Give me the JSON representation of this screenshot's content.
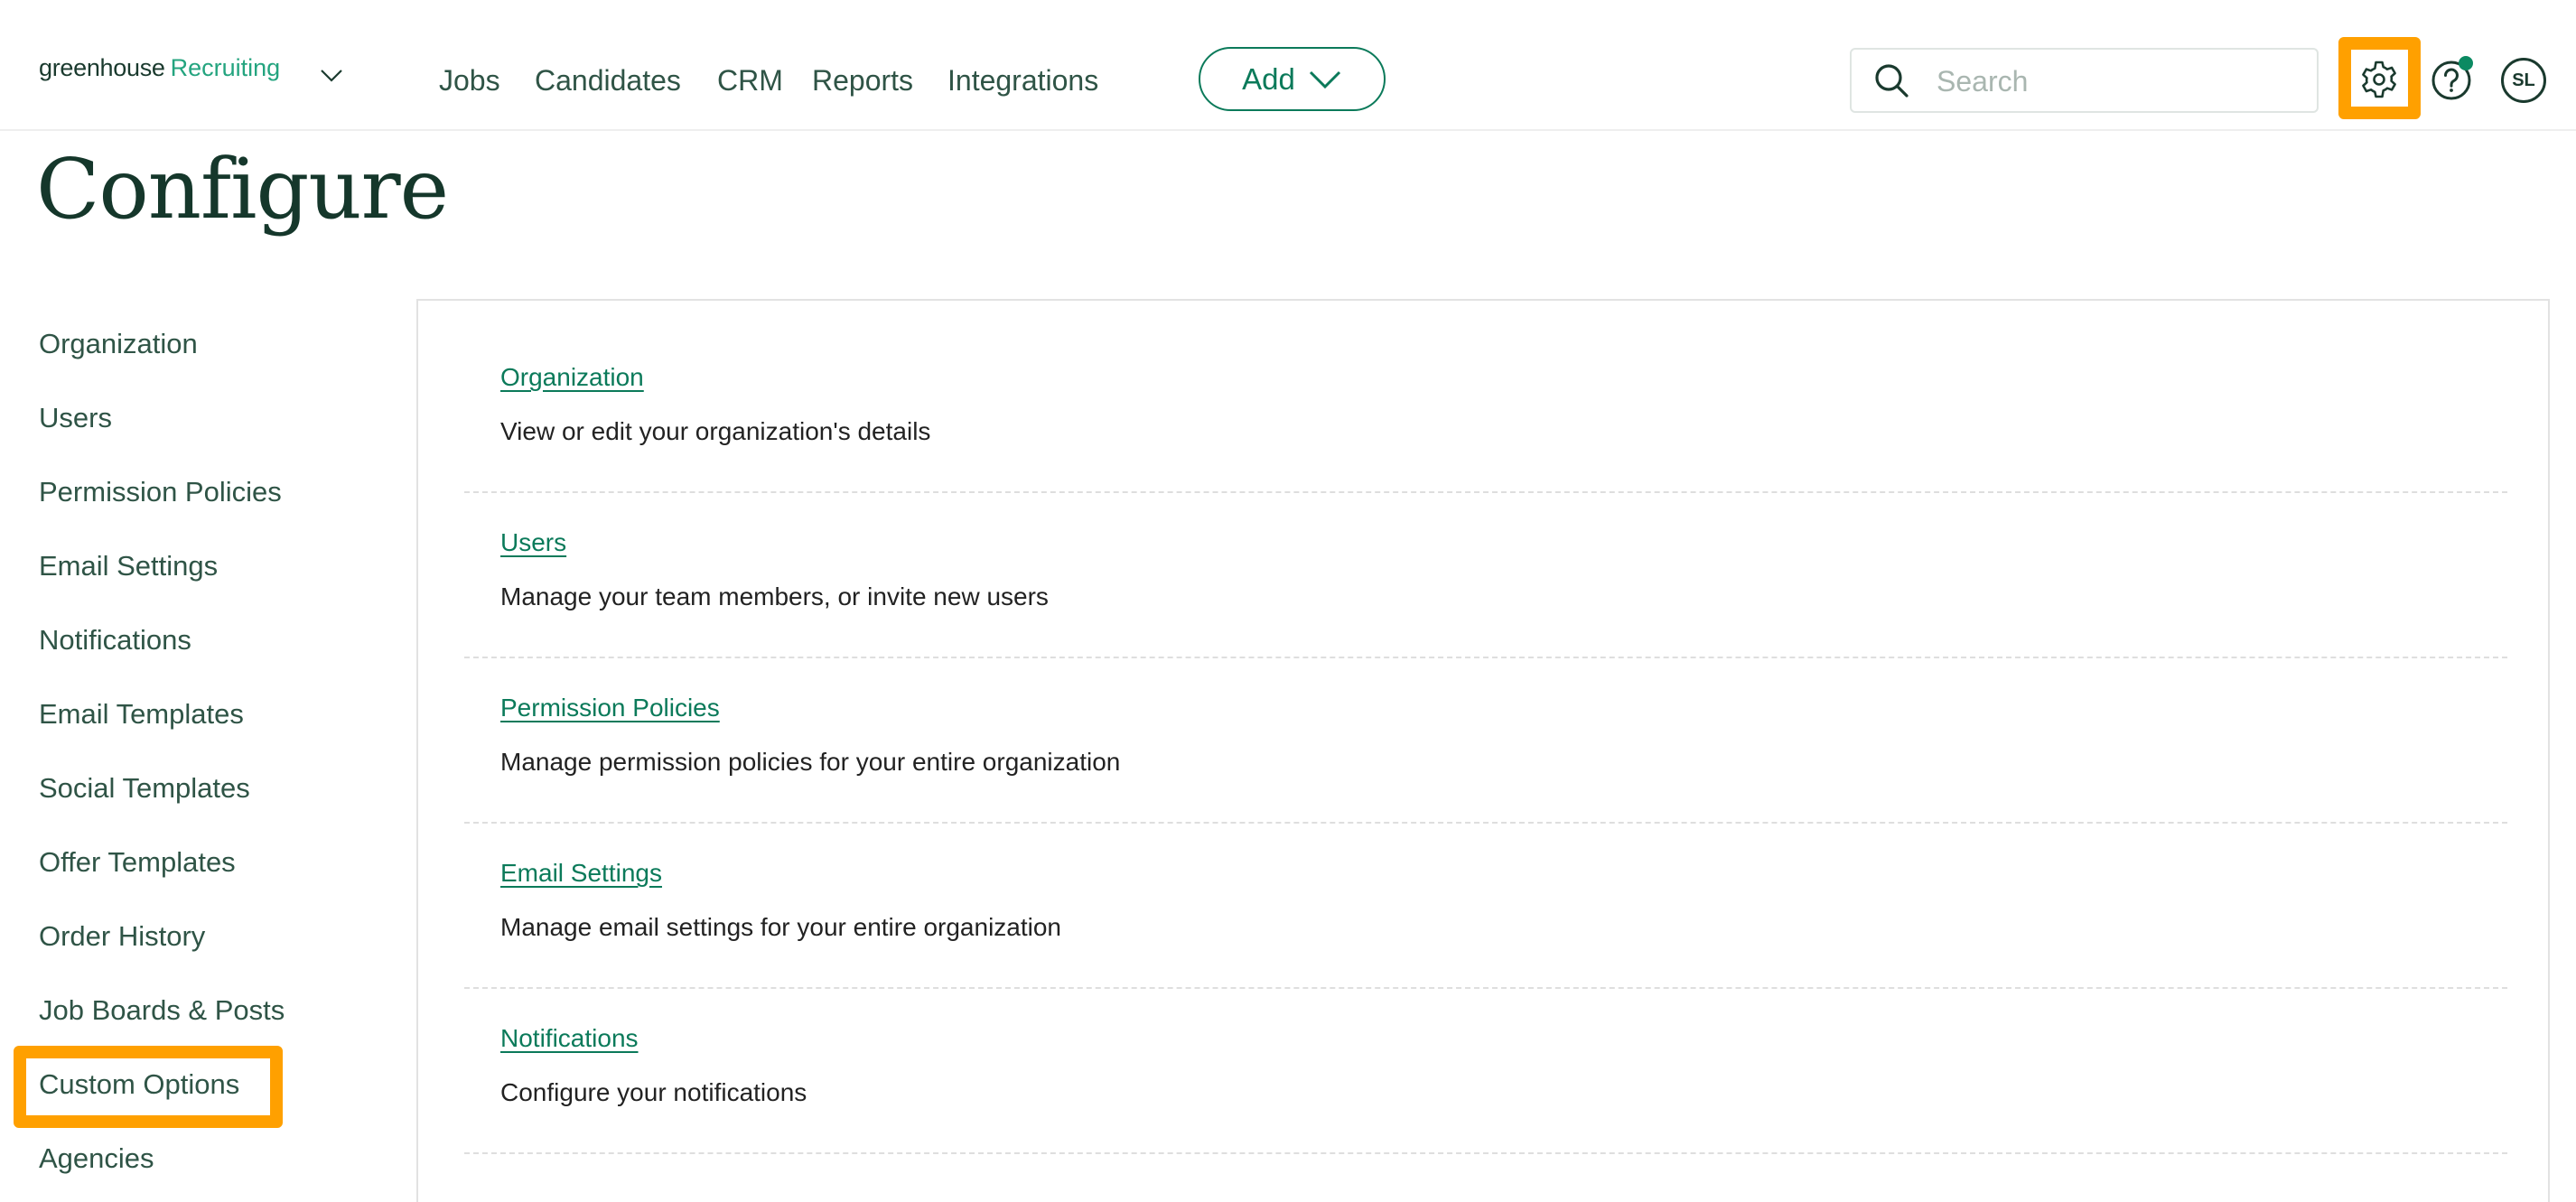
{
  "header": {
    "logo": {
      "brand": "greenhouse",
      "product": "Recruiting"
    },
    "nav": [
      {
        "label": "Jobs"
      },
      {
        "label": "Candidates"
      },
      {
        "label": "CRM"
      },
      {
        "label": "Reports"
      },
      {
        "label": "Integrations"
      }
    ],
    "add_button": {
      "label": "Add"
    },
    "search": {
      "placeholder": "Search",
      "value": ""
    },
    "icons": {
      "settings": "gear-icon",
      "help": "question-circle-icon",
      "search": "magnifier-icon"
    },
    "avatar": {
      "initials": "SL"
    },
    "help_has_notification": true
  },
  "page": {
    "title": "Configure"
  },
  "sidebar": {
    "items": [
      {
        "label": "Organization"
      },
      {
        "label": "Users"
      },
      {
        "label": "Permission Policies"
      },
      {
        "label": "Email Settings"
      },
      {
        "label": "Notifications"
      },
      {
        "label": "Email Templates"
      },
      {
        "label": "Social Templates"
      },
      {
        "label": "Offer Templates"
      },
      {
        "label": "Order History"
      },
      {
        "label": "Job Boards & Posts"
      },
      {
        "label": "Custom Options",
        "highlighted": true
      },
      {
        "label": "Agencies"
      }
    ]
  },
  "main": {
    "sections": [
      {
        "title": "Organization",
        "description": "View or edit your organization's details"
      },
      {
        "title": "Users",
        "description": "Manage your team members, or invite new users"
      },
      {
        "title": "Permission Policies",
        "description": "Manage permission policies for your entire organization"
      },
      {
        "title": "Email Settings",
        "description": "Manage email settings for your entire organization"
      },
      {
        "title": "Notifications",
        "description": "Configure your notifications"
      }
    ]
  },
  "colors": {
    "brand_green": "#0b7a5a",
    "logo_green": "#24a47f",
    "text_dark": "#2f5446",
    "highlight": "#ffa000"
  }
}
